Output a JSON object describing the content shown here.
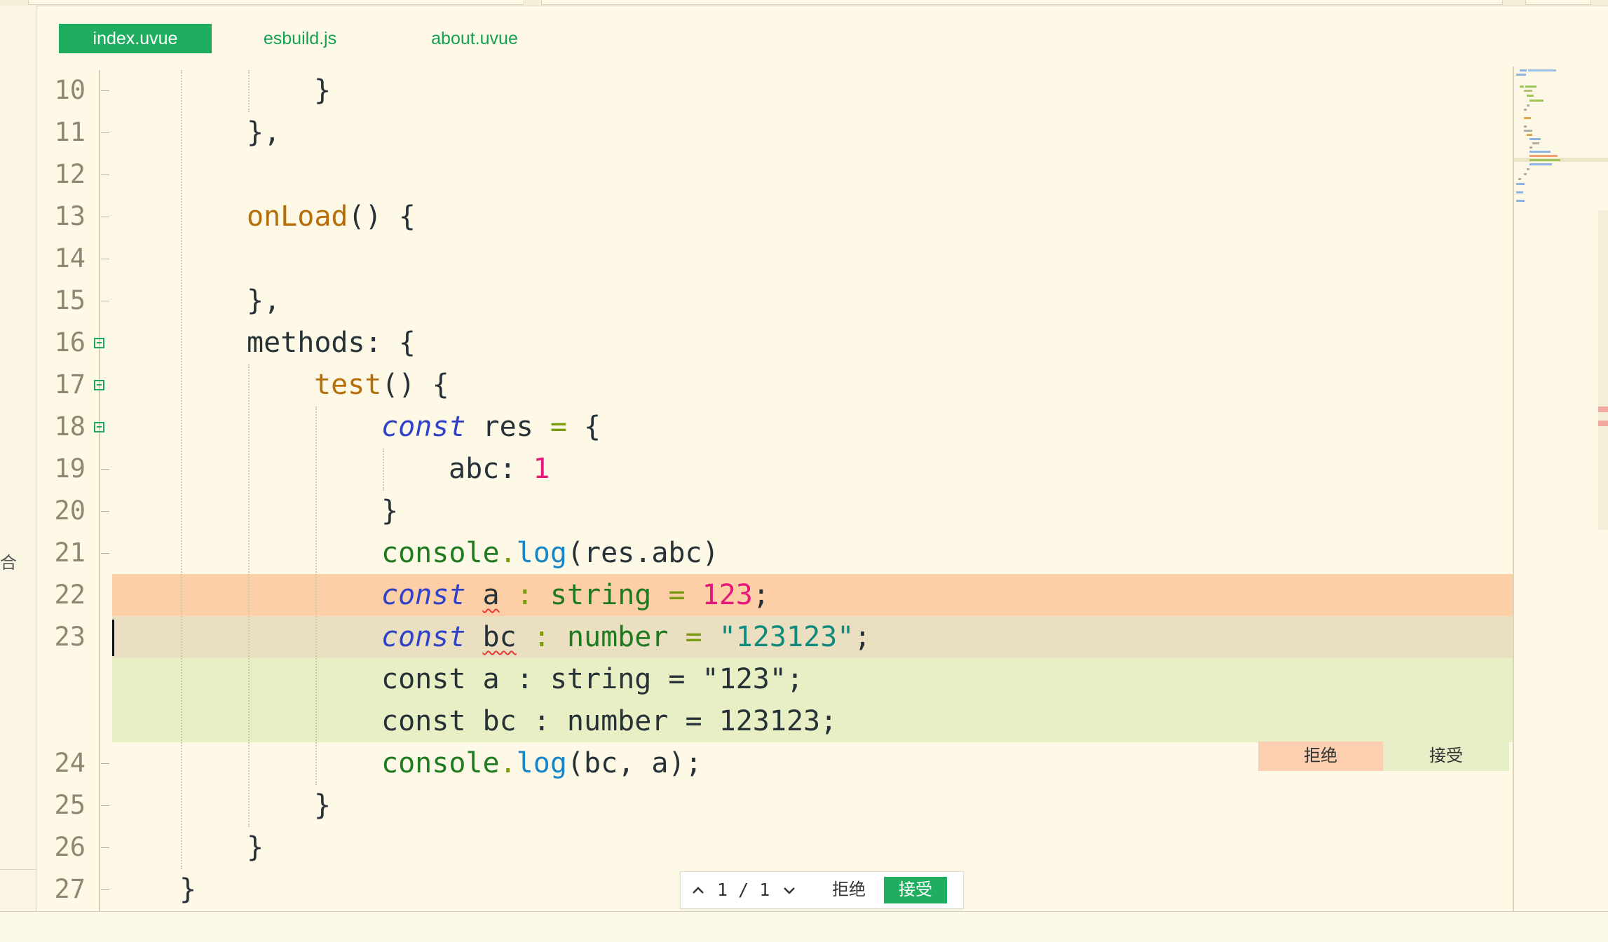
{
  "tabs": [
    {
      "label": "index.uvue",
      "active": true
    },
    {
      "label": "esbuild.js",
      "active": false
    },
    {
      "label": "about.uvue",
      "active": false
    }
  ],
  "sidebar": {
    "glyph": "合"
  },
  "line_numbers": [
    "10",
    "11",
    "12",
    "13",
    "14",
    "15",
    "16",
    "17",
    "18",
    "19",
    "20",
    "21",
    "22",
    "23",
    "24",
    "25",
    "26",
    "27"
  ],
  "code": {
    "l10": {
      "brace": "}"
    },
    "l11": {
      "text": "},"
    },
    "l13": {
      "fn": "onLoad",
      "rest": "() {"
    },
    "l15": {
      "text": "},"
    },
    "l16": {
      "text": "methods: {"
    },
    "l17": {
      "fn": "test",
      "rest": "() {"
    },
    "l18": {
      "kw": "const",
      "name": " res ",
      "op": "=",
      "rest": " {"
    },
    "l19": {
      "key": "abc: ",
      "num": "1"
    },
    "l20": {
      "text": "}"
    },
    "l21": {
      "cls": "console",
      "dot": ".",
      "meth": "log",
      "rest": "(res.abc)"
    },
    "l22": {
      "kw": "const",
      "sp": " ",
      "var": "a",
      "colon": " : ",
      "type": "string",
      "eq": " = ",
      "num": "123",
      "end": ";"
    },
    "l23": {
      "kw": "const",
      "sp": " ",
      "var": "bc",
      "colon": " : ",
      "type": "number",
      "eq": " = ",
      "str": "\"123123\"",
      "end": ";"
    },
    "suggest1": "const a : string = \"123\";",
    "suggest2": "const bc : number = 123123;",
    "l24": {
      "cls": "console",
      "dot": ".",
      "meth": "log",
      "rest": "(bc, a);"
    },
    "l25": {
      "text": "}"
    },
    "l26": {
      "text": "}"
    },
    "l27": {
      "text": "}"
    }
  },
  "inline_actions": {
    "reject": "拒绝",
    "accept": "接受"
  },
  "navigator": {
    "counter": "1 / 1",
    "reject": "拒绝",
    "accept": "接受"
  },
  "colors": {
    "accent": "#1fad5f",
    "editor_bg": "#fdf9e6",
    "removed_bg": "#fdcfa6",
    "added_bg": "#e8efc5",
    "current_line_bg": "#ebdfc2"
  }
}
